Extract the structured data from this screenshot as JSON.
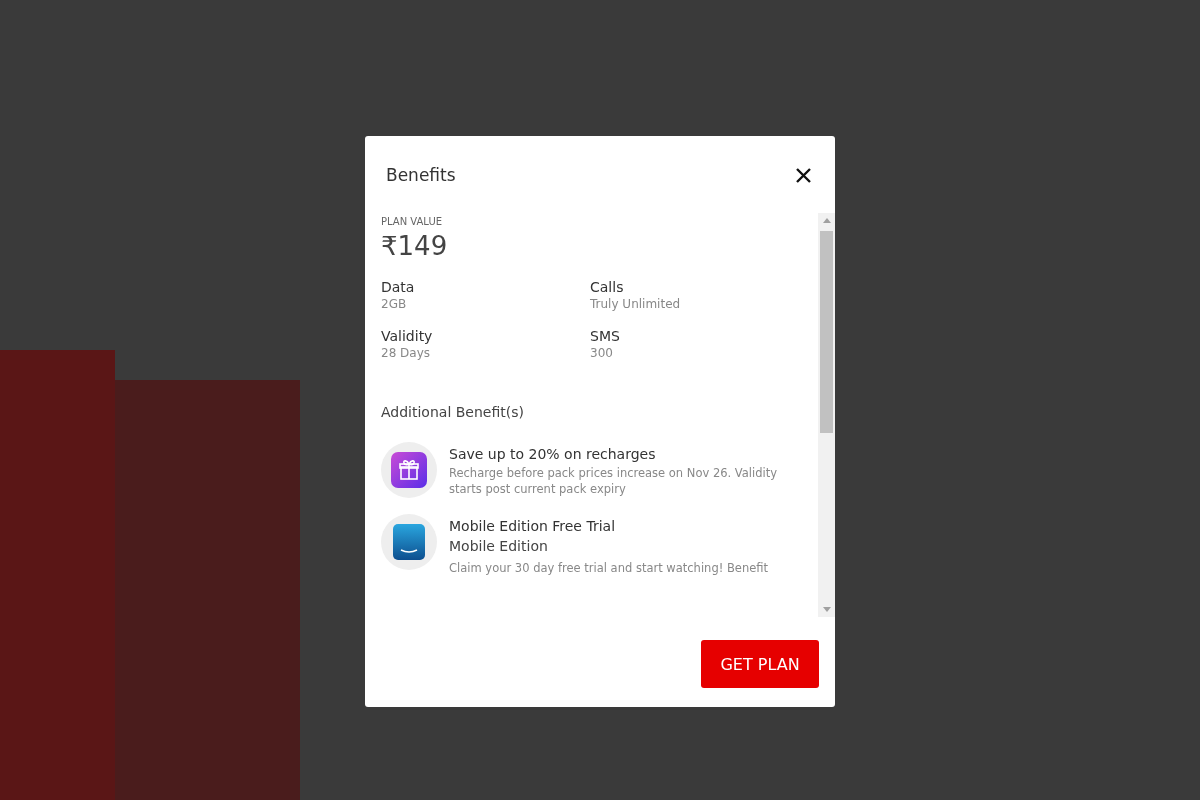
{
  "dialog": {
    "title": "Benefits",
    "plan_value_label": "PLAN VALUE",
    "plan_value": "₹149",
    "specs": [
      {
        "label": "Data",
        "value": "2GB"
      },
      {
        "label": "Calls",
        "value": "Truly Unlimited"
      },
      {
        "label": "Validity",
        "value": "28 Days"
      },
      {
        "label": "SMS",
        "value": "300"
      }
    ],
    "additional_title": "Additional Benefit(s)",
    "benefits": [
      {
        "kind": "gift",
        "title": "Save up to 20% on recharges",
        "lines": [
          {
            "text": "Recharge before pack prices increase on Nov 26. Validity starts post current pack expiry",
            "kind": "description"
          }
        ]
      },
      {
        "kind": "video",
        "title": "Mobile Edition Free Trial",
        "lines": [
          {
            "text": "Mobile Edition",
            "kind": "subtitle"
          },
          {
            "text": "Claim your 30 day free trial and start watching! Benefit",
            "kind": "description"
          }
        ]
      }
    ],
    "button": "GET PLAN"
  }
}
